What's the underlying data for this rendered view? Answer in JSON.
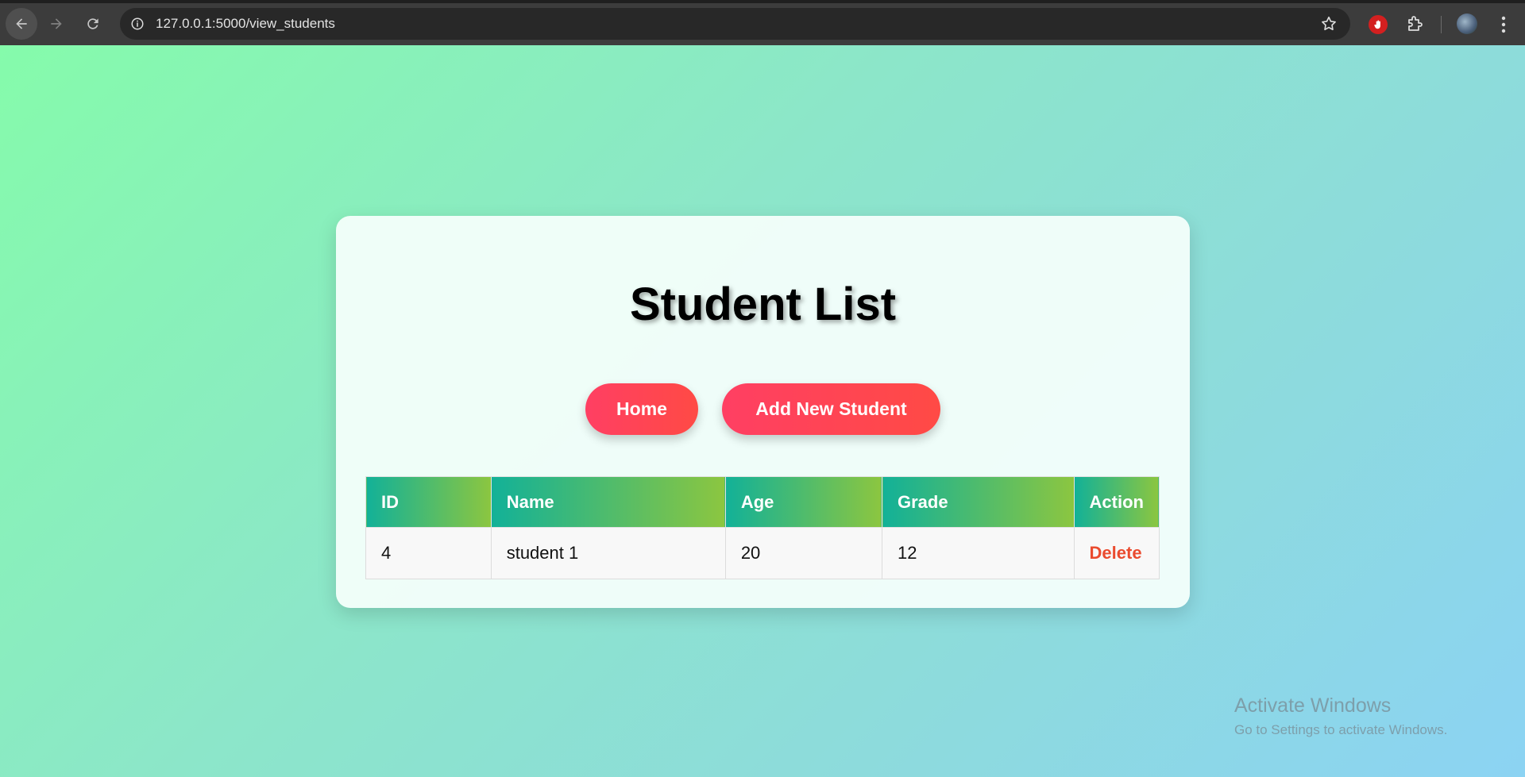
{
  "browser": {
    "url": "127.0.0.1:5000/view_students"
  },
  "page": {
    "title": "Student List",
    "buttons": {
      "home": "Home",
      "add": "Add New Student"
    },
    "table": {
      "headers": [
        "ID",
        "Name",
        "Age",
        "Grade",
        "Action"
      ],
      "rows": [
        {
          "id": "4",
          "name": "student 1",
          "age": "20",
          "grade": "12",
          "action": "Delete"
        }
      ]
    }
  },
  "watermark": {
    "title": "Activate Windows",
    "subtitle": "Go to Settings to activate Windows."
  },
  "colors": {
    "button": "#ff4358",
    "header_start": "#12b198",
    "header_end": "#8cc640",
    "delete": "#ea4b2f"
  },
  "icons": [
    "back-arrow-icon",
    "forward-arrow-icon",
    "reload-icon",
    "site-info-icon",
    "star-icon",
    "extension-hand-icon",
    "puzzle-icon",
    "avatar",
    "kebab-menu-icon"
  ]
}
